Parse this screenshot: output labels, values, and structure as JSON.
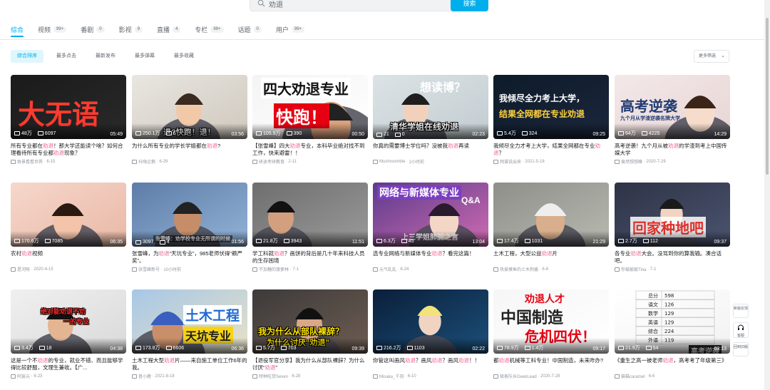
{
  "search": {
    "query": "劝退",
    "button": "搜索"
  },
  "tabs": [
    {
      "label": "综合",
      "count": ""
    },
    {
      "label": "视频",
      "count": "99+"
    },
    {
      "label": "番剧",
      "count": "0"
    },
    {
      "label": "影视",
      "count": "9"
    },
    {
      "label": "直播",
      "count": "4"
    },
    {
      "label": "专栏",
      "count": "99+"
    },
    {
      "label": "话题",
      "count": "0"
    },
    {
      "label": "用户",
      "count": "99+"
    }
  ],
  "sorts": [
    "综合排序",
    "最多点击",
    "最新发布",
    "最多弹幕",
    "最多收藏"
  ],
  "more_filter": "更多筛选",
  "videos": [
    {
      "views": "48万",
      "danmaku": "6097",
      "duration": "05:49",
      "title": "所有专业都在劝退！那大学还能读个啥？如何合理看待所有专业都劝退现象？",
      "uploader": "致景看看世界",
      "date": "6-15",
      "overlay": "大无语"
    },
    {
      "views": "250.1万",
      "danmaku": "6",
      "duration": "03:56",
      "title": "为什么所有专业的学长学姐都在劝退?",
      "uploader": "抖嗨企鹅",
      "date": "6-29",
      "overlay": "退?快跑！退！"
    },
    {
      "views": "105.9万",
      "danmaku": "390",
      "duration": "00:50",
      "title": "【张雪峰】四大劝退专业，本科毕业绝对找不到工作，快来避雷！！",
      "uploader": "研途考研教育",
      "date": "2-11",
      "overlay": "四大劝退专业",
      "overlay2": "快跑！"
    },
    {
      "views": "21",
      "danmaku": "0",
      "duration": "02:23",
      "title": "你真的需要博士学位吗？没被我劝退再读",
      "uploader": "Mushroombie",
      "date": "2小时前",
      "overlay": "想读博？",
      "overlay2": "清华学姐在线劝退"
    },
    {
      "views": "5.4万",
      "danmaku": "324",
      "duration": "09:25",
      "title": "我倾尽全力才考上大学，结果全网都在专业劝退？",
      "uploader": "网课说出来",
      "date": "2021-5-18",
      "overlay": "我倾尽全力考上大学，",
      "overlay2": "结果全网都在专业劝退"
    },
    {
      "views": "64万",
      "danmaku": "4225",
      "duration": "14:29",
      "title": "高考逆袭！九个月从被劝退的学渣到考上中国传媒大学",
      "uploader": "竟然想想嘛",
      "date": "2020-7-29",
      "overlay": "高考逆袭",
      "overlay2": "九个月从学渣逆袭名牌大学"
    },
    {
      "views": "170.6万",
      "danmaku": "7085",
      "duration": "06:35",
      "title": "农村劝退视频",
      "uploader": "是河呀",
      "date": "2020-4-15",
      "overlay": ""
    },
    {
      "views": "3097",
      "danmaku": "4",
      "duration": "01:56",
      "title": "张雪峰，为劝退“天坑专业”，985老师伏得“赖严奖”。",
      "uploader": "张雪峰新号",
      "date": "10小时前",
      "overlay": "张雪峰：劝学校专业无所谓的时候"
    },
    {
      "views": "21.8万",
      "danmaku": "3943",
      "duration": "11:51",
      "title": "学工科就劝退？画饼的背后是几十年来科技人员的生存困境",
      "uploader": "不加糖的菠萝林",
      "date": "7-1",
      "overlay": ""
    },
    {
      "views": "6.3万",
      "danmaku": "45",
      "duration": "13:04",
      "title": "选专业网络与新媒体专业劝退？看完这篇！",
      "uploader": "元气乱乱",
      "date": "6-24",
      "overlay": "网络与新媒体专业",
      "overlay2": "Q&A",
      "overlay3": "上三学姐肺腑之言"
    },
    {
      "views": "17.4万",
      "danmaku": "1031",
      "duration": "21:29",
      "title": "土木工程，大型公益劝退片",
      "uploader": "热爱摸鱼的土木狗酱",
      "date": "6-8",
      "overlay": ""
    },
    {
      "views": "2.7万",
      "danmaku": "112",
      "duration": "09:37",
      "title": "各专业劝退大会。没骂到你的算我输。凑合话吧。",
      "uploader": "你被敲敲Tina",
      "date": "7-1",
      "overlay": "回家种地吧"
    },
    {
      "views": "3.4万",
      "danmaku": "18",
      "duration": "04:38",
      "title": "这是一个不劝退的专业，就业不错、而且能够学得比较舒服，文理生兼收。【广...",
      "uploader": "阿宸元",
      "date": "6-23",
      "overlay": "绝对能劝退不劝",
      "overlay2": "一的专业"
    },
    {
      "views": "173.8万",
      "danmaku": "6606",
      "duration": "06:36",
      "title": "土木工程大型劝退片——来自施工单位工作6年的我。",
      "uploader": "普小鹿",
      "date": "2021-8-18",
      "overlay": "土木工程",
      "overlay2": "天坑专业"
    },
    {
      "views": "5.7万",
      "danmaku": "703",
      "duration": "09:39",
      "title": "【退役军官分享】我为什么从部队裸辞？为什么讨厌“劝退”",
      "uploader": "特种吃货Seven",
      "date": "6-28",
      "overlay": "我为什么从部队裸辞？",
      "overlay2": "为什么讨厌“劝退”"
    },
    {
      "views": "216.2万",
      "danmaku": "1103",
      "duration": "02:22",
      "title": "你管这叫画风劝退？画风劝退？画风劝退！！",
      "uploader": "Misaka_千羽",
      "date": "6-10",
      "overlay": ""
    },
    {
      "views": "78.9万",
      "danmaku": "1.4万",
      "duration": "09:17",
      "title": "都劝退机械等工科专业！中国制造，未来咋办?",
      "uploader": "极客队长GeekLead",
      "date": "2020-7-28",
      "overlay": "劝退人才",
      "overlay2": "中国制造",
      "overlay3": "危机四伏！"
    },
    {
      "views": "21.9万",
      "danmaku": "54",
      "duration": "03:13",
      "title": "《重生之高一被老师劝退，高考考了年级第三》",
      "uploader": "猫猫caramel",
      "date": "6-6",
      "overlay": "高考逆袭",
      "table": [
        [
          "总分",
          "598"
        ],
        [
          "语文",
          "126"
        ],
        [
          "数学",
          "129"
        ],
        [
          "英语",
          "129"
        ],
        [
          "综合",
          "224"
        ],
        [
          "外语",
          "119"
        ]
      ]
    }
  ],
  "side_buttons": [
    "新版反馈",
    "客服",
    "回到旧版"
  ],
  "colors": {
    "accent": "#00aeec",
    "highlight": "#f25d8e"
  }
}
